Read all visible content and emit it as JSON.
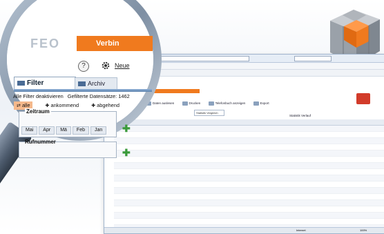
{
  "app": {
    "brand": "FEO",
    "header_button": "Verbin",
    "new_label": "Neue",
    "help_icon": "?"
  },
  "tabs": [
    {
      "label": "Filter",
      "active": true
    },
    {
      "label": "Archiv",
      "active": false
    }
  ],
  "filter": {
    "deactivate_all": "Alle Filter deaktivieren",
    "filtered_count": "Gefilterte Datensätze: 1462",
    "direction": {
      "all": "alle",
      "incoming": "ankommend",
      "outgoing": "abgehend"
    },
    "timerange": {
      "label": "Zeitraum",
      "months": [
        "Mai",
        "Apr",
        "Mä",
        "Feb",
        "Jan"
      ]
    },
    "number": {
      "label": "Rufnummer"
    }
  },
  "background_window": {
    "toolbar": {
      "buttons": [
        "Daten auslesen",
        "Drucken",
        "Telefonbuch anzeigen",
        "Export"
      ],
      "search_value": "Statistik Vergleich"
    },
    "subtabs": [
      "Statistik Verlauf"
    ],
    "status_text": "Internet",
    "zoom": "100%"
  },
  "colors": {
    "accent": "#f07a1e",
    "tab_stripe": "#5c82ad",
    "add": "#3a9a3a"
  },
  "icons": [
    "help-icon",
    "settings-icon",
    "filter-tab-icon",
    "archiv-tab-icon",
    "add-icon",
    "cube-logo"
  ]
}
